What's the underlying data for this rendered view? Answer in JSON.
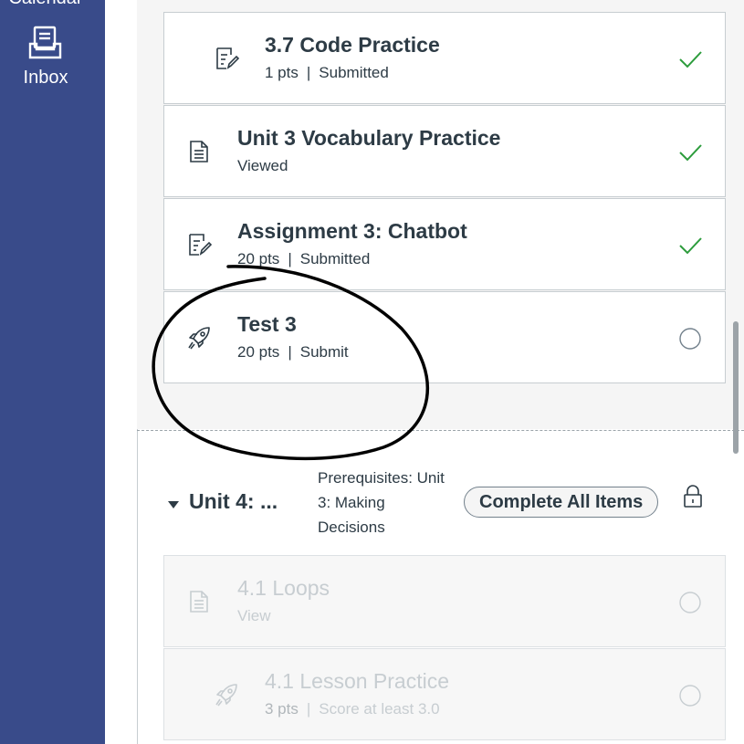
{
  "global_nav": {
    "partial_label": "Calendar",
    "inbox_label": "Inbox"
  },
  "items": [
    {
      "title": "3.7 Code Practice",
      "points": "1 pts",
      "status_text": "Submitted",
      "icon": "assignment-icon",
      "completed": true
    },
    {
      "title": "Unit 3 Vocabulary Practice",
      "status_text": "Viewed",
      "icon": "page-icon",
      "completed": true
    },
    {
      "title": "Assignment 3: Chatbot",
      "points": "20 pts",
      "status_text": "Submitted",
      "icon": "assignment-icon",
      "completed": true
    },
    {
      "title": "Test 3",
      "points": "20 pts",
      "status_text": "Submit",
      "icon": "quiz-icon",
      "completed": false
    }
  ],
  "separator": "|",
  "module": {
    "title": "Unit 4: ...",
    "prerequisites": "Prerequisites: Unit 3: Making Decisions",
    "requirement_pill": "Complete All Items",
    "locked": true,
    "items": [
      {
        "title": "4.1 Loops",
        "status_text": "View",
        "icon": "page-icon"
      },
      {
        "title": "4.1 Lesson Practice",
        "points": "3 pts",
        "status_text": "Score at least 3.0",
        "icon": "quiz-icon"
      }
    ]
  },
  "colors": {
    "nav_bg": "#394b8a",
    "check_green": "#2c9c3c",
    "text": "#2d3b45"
  }
}
